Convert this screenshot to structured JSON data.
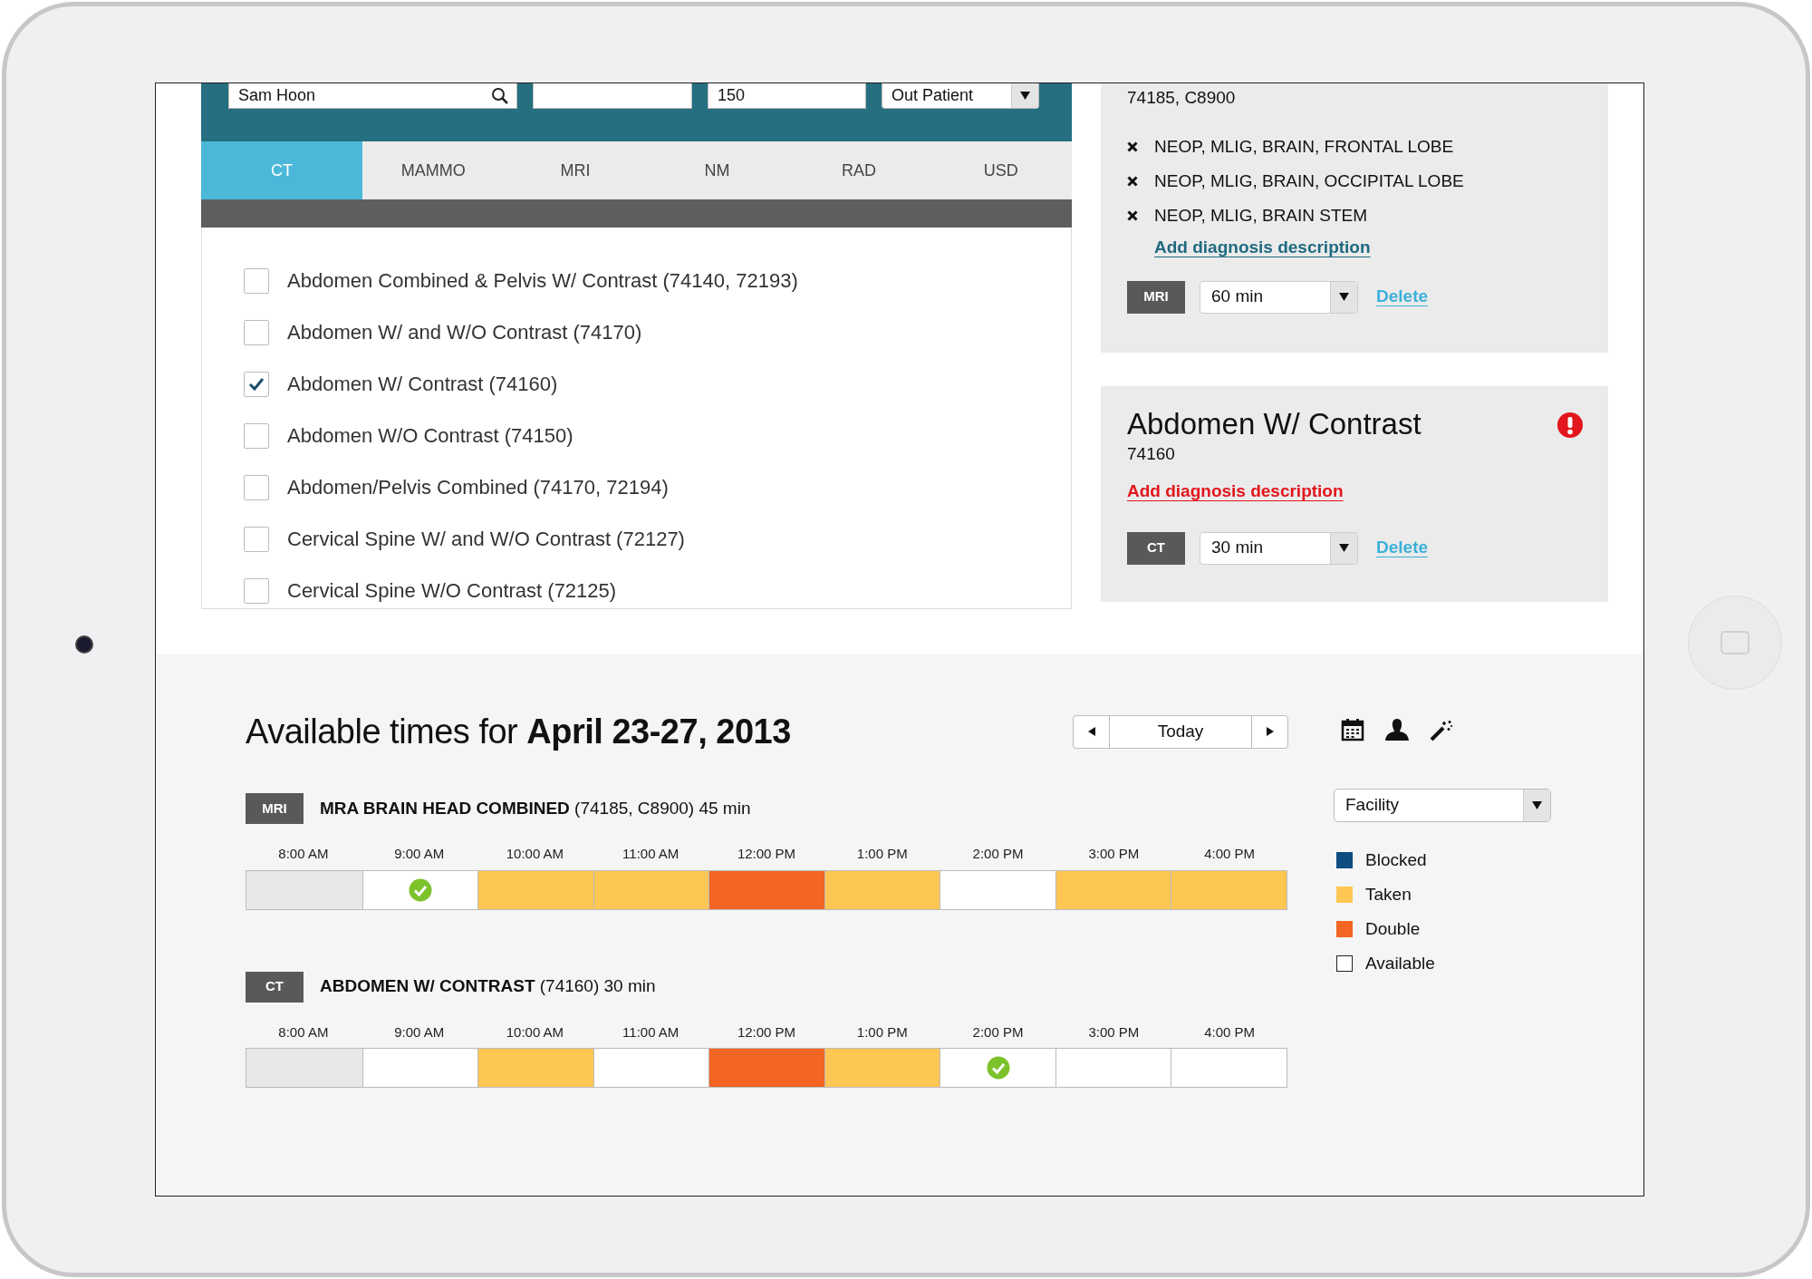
{
  "patient_fields": [
    {
      "kind": "search",
      "value": "Sam Hoon"
    },
    {
      "kind": "text"
    },
    {
      "kind": "text",
      "value": "150"
    },
    {
      "kind": "select",
      "value": "Out Patient"
    }
  ],
  "tabs": [
    {
      "label": "CT",
      "selected": true
    },
    {
      "label": "MAMMO",
      "selected": false
    },
    {
      "label": "MRI",
      "selected": false
    },
    {
      "label": "NM",
      "selected": false
    },
    {
      "label": "RAD",
      "selected": false
    },
    {
      "label": "USD",
      "selected": false
    }
  ],
  "procedures": [
    {
      "label": "Abdomen Combined & Pelvis W/ Contrast (74140, 72193)",
      "checked": false
    },
    {
      "label": "Abdomen W/ and W/O Contrast (74170)",
      "checked": false
    },
    {
      "label": "Abdomen W/ Contrast (74160)",
      "checked": true
    },
    {
      "label": "Abdomen W/O Contrast (74150)",
      "checked": false
    },
    {
      "label": "Abdomen/Pelvis Combined (74170, 72194)",
      "checked": false
    },
    {
      "label": "Cervical Spine W/ and W/O Contrast (72127)",
      "checked": false
    },
    {
      "label": "Cervical Spine W/O Contrast (72125)",
      "checked": false
    }
  ],
  "orders": [
    {
      "codes": "74185, C8900",
      "diagnoses": [
        "NEOP, MLIG, BRAIN, FRONTAL LOBE",
        "NEOP, MLIG, BRAIN, OCCIPITAL LOBE",
        "NEOP, MLIG, BRAIN STEM"
      ],
      "add_link": "Add diagnosis description",
      "warning": false,
      "modality": "MRI",
      "duration": "60 min",
      "delete": "Delete"
    },
    {
      "title": "Abdomen W/ Contrast",
      "codes": "74160",
      "add_link": "Add diagnosis description",
      "warning": true,
      "modality": "CT",
      "duration": "30 min",
      "delete": "Delete"
    }
  ],
  "schedule": {
    "heading": "Available times for **April 23-27, 2013**",
    "today": "Today",
    "rows": [
      {
        "modality": "MRI",
        "title": "**MRA BRAIN HEAD COMBINED** (74185, C8900) 45 min",
        "slots": [
          {
            "time": "8:00 AM",
            "kind": "past",
            "selected": false
          },
          {
            "time": "9:00 AM",
            "kind": "available",
            "selected": true
          },
          {
            "time": "10:00 AM",
            "kind": "taken",
            "selected": false
          },
          {
            "time": "11:00 AM",
            "kind": "taken",
            "selected": false
          },
          {
            "time": "12:00 PM",
            "kind": "double",
            "selected": false
          },
          {
            "time": "1:00 PM",
            "kind": "taken",
            "selected": false
          },
          {
            "time": "2:00 PM",
            "kind": "available",
            "selected": false
          },
          {
            "time": "3:00 PM",
            "kind": "taken",
            "selected": false
          },
          {
            "time": "4:00 PM",
            "kind": "taken",
            "selected": false
          }
        ]
      },
      {
        "modality": "CT",
        "title": "**ABDOMEN W/ CONTRAST** (74160) 30 min",
        "slots": [
          {
            "time": "8:00 AM",
            "kind": "past",
            "selected": false
          },
          {
            "time": "9:00 AM",
            "kind": "available",
            "selected": false
          },
          {
            "time": "10:00 AM",
            "kind": "taken",
            "selected": false
          },
          {
            "time": "11:00 AM",
            "kind": "available",
            "selected": false
          },
          {
            "time": "12:00 PM",
            "kind": "double",
            "selected": false
          },
          {
            "time": "1:00 PM",
            "kind": "taken",
            "selected": false
          },
          {
            "time": "2:00 PM",
            "kind": "available",
            "selected": true
          },
          {
            "time": "3:00 PM",
            "kind": "available",
            "selected": false
          },
          {
            "time": "4:00 PM",
            "kind": "available",
            "selected": false
          }
        ]
      }
    ],
    "filter": "Facility",
    "legend": [
      {
        "label": "Blocked",
        "color": "#0f4c81"
      },
      {
        "label": "Taken",
        "color": "#fec653"
      },
      {
        "label": "Double",
        "color": "#f26522"
      },
      {
        "label": "Available",
        "color": "#ffffff"
      }
    ]
  }
}
